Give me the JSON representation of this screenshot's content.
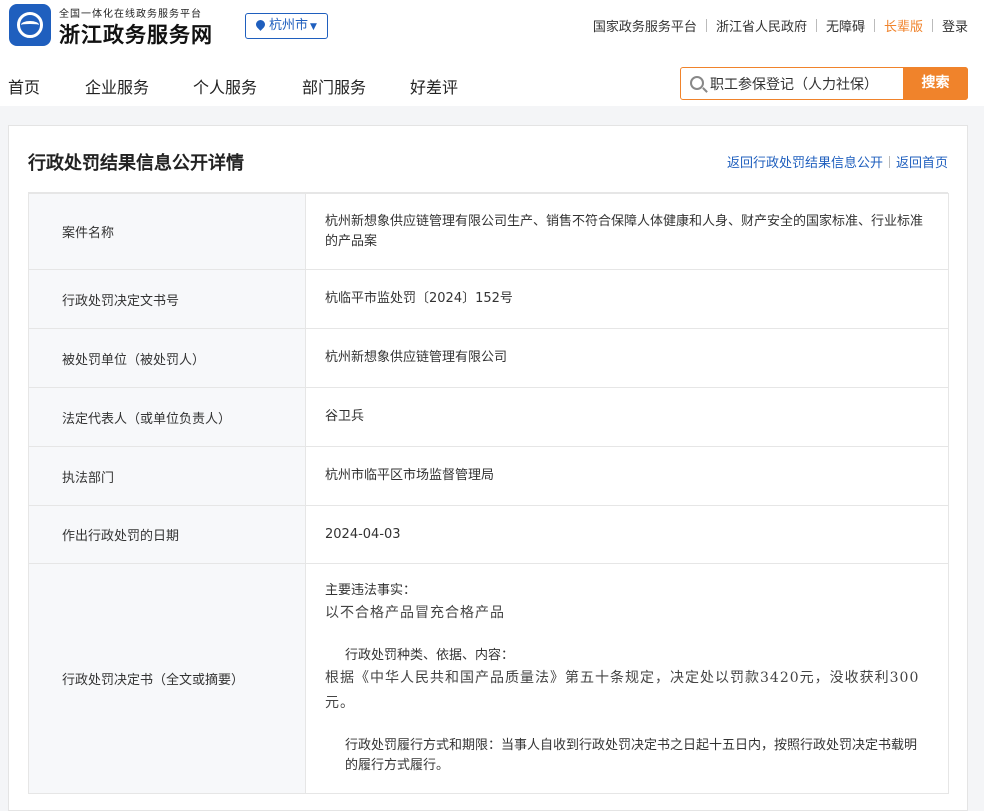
{
  "header": {
    "brand_sub": "全国一体化在线政务服务平台",
    "brand_main": "浙江政务服务网",
    "city": "杭州市",
    "top_links": [
      "国家政务服务平台",
      "浙江省人民政府",
      "无障碍",
      "长辈版",
      "登录"
    ]
  },
  "nav": {
    "items": [
      "首页",
      "企业服务",
      "个人服务",
      "部门服务",
      "好差评"
    ],
    "search_value": "职工参保登记（人力社保）",
    "search_button": "搜索"
  },
  "page": {
    "title": "行政处罚结果信息公开详情",
    "back_list": "返回行政处罚结果信息公开",
    "back_home": "返回首页"
  },
  "rows": [
    {
      "label": "案件名称",
      "value": "杭州新想象供应链管理有限公司生产、销售不符合保障人体健康和人身、财产安全的国家标准、行业标准的产品案"
    },
    {
      "label": "行政处罚决定文书号",
      "value": "杭临平市监处罚〔2024〕152号"
    },
    {
      "label": "被处罚单位（被处罚人）",
      "value": "杭州新想象供应链管理有限公司"
    },
    {
      "label": "法定代表人（或单位负责人）",
      "value": "谷卫兵"
    },
    {
      "label": "执法部门",
      "value": "杭州市临平区市场监督管理局"
    },
    {
      "label": "作出行政处罚的日期",
      "value": "2024-04-03"
    },
    {
      "label": "行政处罚决定书（全文或摘要）"
    }
  ],
  "decision": {
    "facts_heading": "主要违法事实：",
    "facts_text": "以不合格产品冒充合格产品",
    "basis_heading": "行政处罚种类、依据、内容：",
    "basis_text": "根据《中华人民共和国产品质量法》第五十条规定，决定处以罚款3420元，没收获利300元。",
    "method_text": "行政处罚履行方式和期限：当事人自收到行政处罚决定书之日起十五日内，按照行政处罚决定书载明的履行方式履行。"
  }
}
